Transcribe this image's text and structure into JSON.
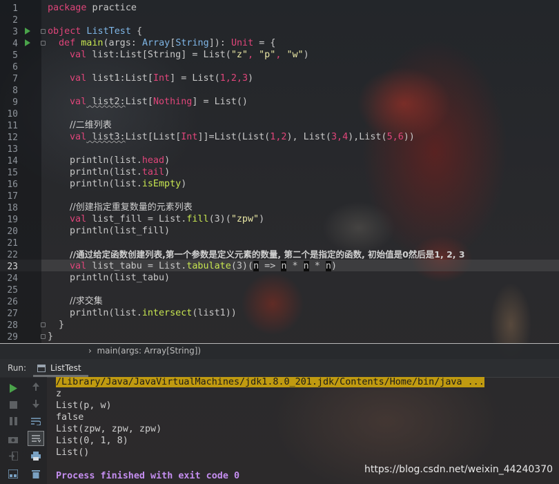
{
  "editor": {
    "line_numbers": [
      "1",
      "2",
      "3",
      "4",
      "5",
      "6",
      "7",
      "8",
      "9",
      "10",
      "11",
      "12",
      "13",
      "14",
      "15",
      "16",
      "17",
      "18",
      "19",
      "20",
      "21",
      "22",
      "23",
      "24",
      "25",
      "26",
      "27",
      "28",
      "29"
    ],
    "current_line": "23",
    "code": {
      "l1_kw": "package",
      "l1_name": " practice",
      "l3_kw": "object",
      "l3_name": " ListTest",
      "l3_brace": " {",
      "l4_kw": "def",
      "l4_fn": " main",
      "l4_a": "(args: ",
      "l4_type": "Array",
      "l4_b": "[",
      "l4_type2": "String",
      "l4_c": "]): ",
      "l4_ret": "Unit",
      "l4_d": " = {",
      "l5_kw": "val",
      "l5_a": " list:",
      "l5_type": "List",
      "l5_b": "[",
      "l5_type2": "String",
      "l5_c": "] = List(",
      "l5_s1": "\"z\"",
      "l5_comma1": ", ",
      "l5_s2": "\"p\"",
      "l5_comma2": ", ",
      "l5_s3": "\"w\"",
      "l5_d": ")",
      "l7_kw": "val",
      "l7_a": " list1:",
      "l7_type": "List",
      "l7_b": "[",
      "l7_type2": "Int",
      "l7_c": "] = List(",
      "l7_n1": "1",
      "l7_co1": ",",
      "l7_n2": "2",
      "l7_co2": ",",
      "l7_n3": "3",
      "l7_d": ")",
      "l9_kw": "val",
      "l9_a": " list2:",
      "l9_type": "List",
      "l9_b": "[",
      "l9_type2": "Nothing",
      "l9_c": "] = List()",
      "l11_comment": "//二维列表",
      "l12_kw": "val",
      "l12_a": " list3:",
      "l12_type": "List",
      "l12_b": "[",
      "l12_type2": "List",
      "l12_c": "[",
      "l12_type3": "Int",
      "l12_d": "]]=List(List(",
      "l12_n1": "1",
      "l12_co1": ",",
      "l12_n2": "2",
      "l12_e": "), List(",
      "l12_n3": "3",
      "l12_co2": ",",
      "l12_n4": "4",
      "l12_f": "),List(",
      "l12_n5": "5",
      "l12_co3": ",",
      "l12_n6": "6",
      "l12_g": "))",
      "l14_a": "println(list.",
      "l14_p": "head",
      "l14_b": ")",
      "l15_a": "println(list.",
      "l15_p": "tail",
      "l15_b": ")",
      "l16_a": "println(list.",
      "l16_p": "isEmpty",
      "l16_b": ")",
      "l18_comment": "//创建指定重复数量的元素列表",
      "l19_kw": "val",
      "l19_a": " list_fill = List.",
      "l19_f": "fill",
      "l19_b": "(3)(",
      "l19_s": "\"zpw\"",
      "l19_c": ")",
      "l20_a": "println(list_fill)",
      "l22_comment": "//通过给定函数创建列表,第一个参数是定义元素的数量, 第二个是指定的函数, 初始值是0然后是1, 2, 3",
      "l23_kw": "val",
      "l23_a": " list_tabu = List.",
      "l23_f": "tabulate",
      "l23_b": "(3)(",
      "l23_h1": "n",
      "l23_c": " => ",
      "l23_h2": "n",
      "l23_d": " * ",
      "l23_h3": "n",
      "l23_e": " * ",
      "l23_h4": "n",
      "l23_g": ")",
      "l24_a": "println(list_tabu)",
      "l26_comment": "//求交集",
      "l27_a": "println(list.",
      "l27_f": "intersect",
      "l27_b": "(list1))",
      "l28_a": "}",
      "l29_a": "}"
    }
  },
  "breadcrumb": {
    "text": "main(args: Array[String])"
  },
  "run_panel": {
    "label": "Run:",
    "tab": "ListTest",
    "output": [
      "/Library/Java/JavaVirtualMachines/jdk1.8.0_201.jdk/Contents/Home/bin/java ...",
      "z",
      "List(p, w)",
      "false",
      "List(zpw, zpw, zpw)",
      "List(0, 1, 8)",
      "List()",
      "",
      "Process finished with exit code 0"
    ]
  },
  "toolbar_icons": [
    "run-icon",
    "stop-icon",
    "pause-icon",
    "camera-icon",
    "login-icon",
    "layout-icon",
    "up-arrow-icon",
    "down-arrow-icon",
    "soft-wrap-icon",
    "scroll-to-end-icon",
    "print-icon",
    "trash-icon"
  ],
  "watermark": "https://blog.csdn.net/weixin_44240370",
  "colors": {
    "keyword": "#e0457a",
    "type": "#7fb6e6",
    "string": "#e9e7a4",
    "function": "#c7e650",
    "property": "#7fc3ee",
    "output_path_bg": "#c09a10",
    "process_text": "#c58ef0"
  }
}
